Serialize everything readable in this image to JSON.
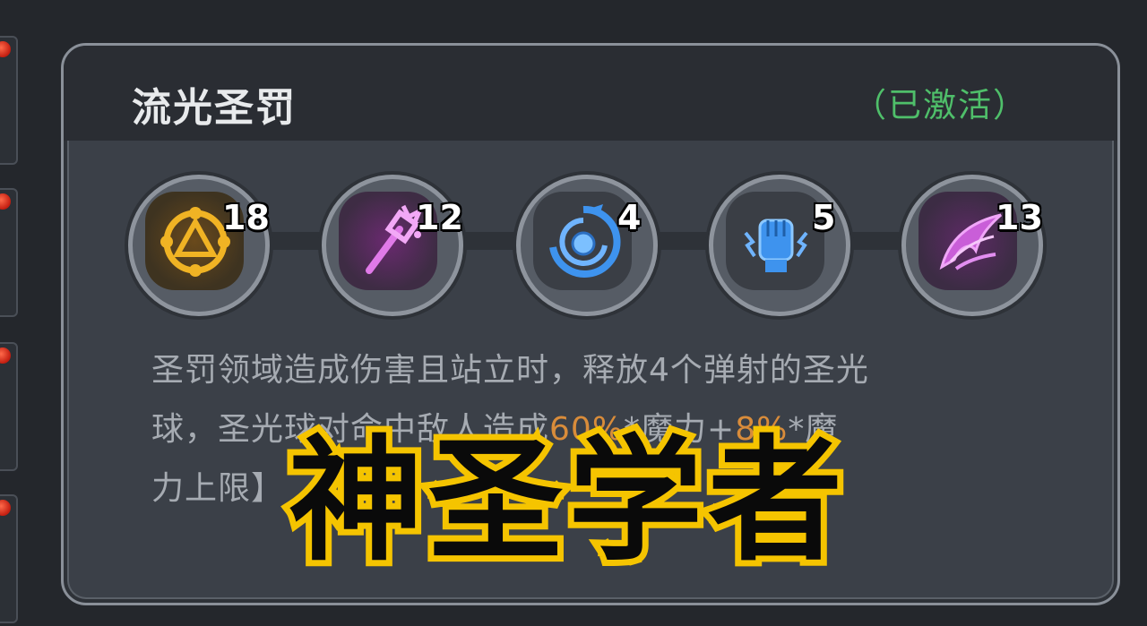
{
  "panel": {
    "title": "流光圣罚",
    "status": "（已激活）"
  },
  "nodes": [
    {
      "icon": "golden-rune-circle-icon",
      "count": "18",
      "color": "#e3a323"
    },
    {
      "icon": "magic-scepter-icon",
      "count": "12",
      "color": "#d060d8"
    },
    {
      "icon": "blue-vortex-icon",
      "count": "4",
      "color": "#3a8de8"
    },
    {
      "icon": "blue-fist-icon",
      "count": "5",
      "color": "#3a8de8"
    },
    {
      "icon": "purple-wing-icon",
      "count": "13",
      "color": "#c25ad3"
    }
  ],
  "description": {
    "line1": "圣罚领域造成伤害且站立时，释放4个弹射的圣光",
    "line2_a": "球，圣光",
    "line2_hidden": "球对命中敌人造成",
    "line2_hl1": "60%",
    "line2_b": "*魔力+",
    "line2_hl2": "8%",
    "line2_c": "*魔",
    "line3": "力上限】"
  },
  "overlay": {
    "text": "神圣学者",
    "fill": "#0a0a0a",
    "stroke": "#f5c400"
  }
}
